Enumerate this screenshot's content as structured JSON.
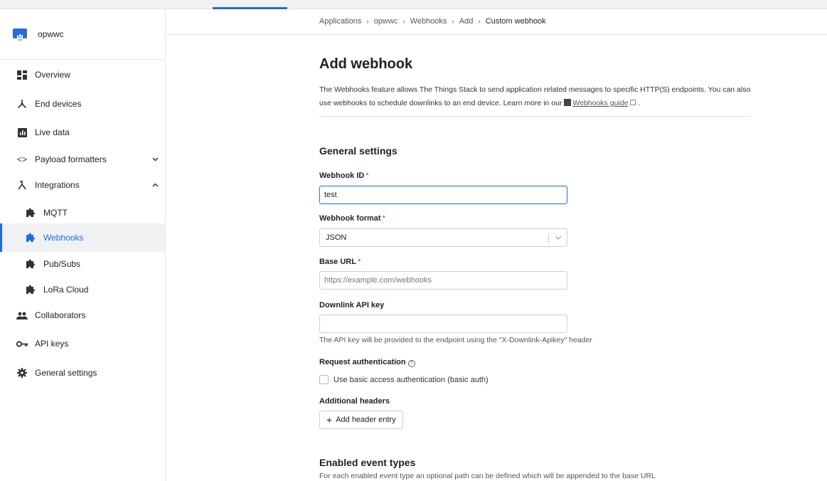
{
  "app": {
    "name": "opwwc"
  },
  "sidebar": {
    "items": [
      {
        "label": "Overview",
        "icon": "grid-icon"
      },
      {
        "label": "End devices",
        "icon": "device-icon"
      },
      {
        "label": "Live data",
        "icon": "chart-icon"
      },
      {
        "label": "Payload formatters",
        "icon": "code-icon",
        "expander": "chevron-down-icon"
      },
      {
        "label": "Integrations",
        "icon": "integration-icon",
        "expander": "chevron-up-icon"
      },
      {
        "label": "MQTT",
        "icon": "puzzle-icon"
      },
      {
        "label": "Webhooks",
        "icon": "puzzle-icon",
        "active": true
      },
      {
        "label": "Pub/Subs",
        "icon": "puzzle-icon"
      },
      {
        "label": "LoRa Cloud",
        "icon": "puzzle-icon"
      },
      {
        "label": "Collaborators",
        "icon": "people-icon"
      },
      {
        "label": "API keys",
        "icon": "key-icon"
      },
      {
        "label": "General settings",
        "icon": "gear-icon"
      }
    ]
  },
  "breadcrumb": [
    "Applications",
    "opwwc",
    "Webhooks",
    "Add",
    "Custom webhook"
  ],
  "page": {
    "title": "Add webhook",
    "intro_text": "The Webhooks feature allows The Things Stack to send application related messages to specific HTTP(S) endpoints. You can also use webhooks to schedule downlinks to an end device. Learn more in our",
    "guide_link": "Webhooks guide",
    "intro_end": "."
  },
  "general_settings": {
    "title": "General settings",
    "webhook_id": {
      "label": "Webhook ID",
      "value": "test"
    },
    "webhook_format": {
      "label": "Webhook format",
      "value": "JSON"
    },
    "base_url": {
      "label": "Base URL",
      "placeholder": "https://example.com/webhooks"
    },
    "downlink_api_key": {
      "label": "Downlink API key",
      "hint": "The API key will be provided to the endpoint using the \"X-Downlink-Apikey\" header"
    },
    "request_auth": {
      "label": "Request authentication",
      "checkbox_label": "Use basic access authentication (basic auth)"
    },
    "additional_headers": {
      "label": "Additional headers",
      "button": "Add header entry"
    }
  },
  "enabled_event_types": {
    "title": "Enabled event types",
    "description": "For each enabled event type an optional path can be defined which will be appended to the base URL"
  },
  "colors": {
    "accent": "#1c6de2",
    "required": "#db2828"
  }
}
